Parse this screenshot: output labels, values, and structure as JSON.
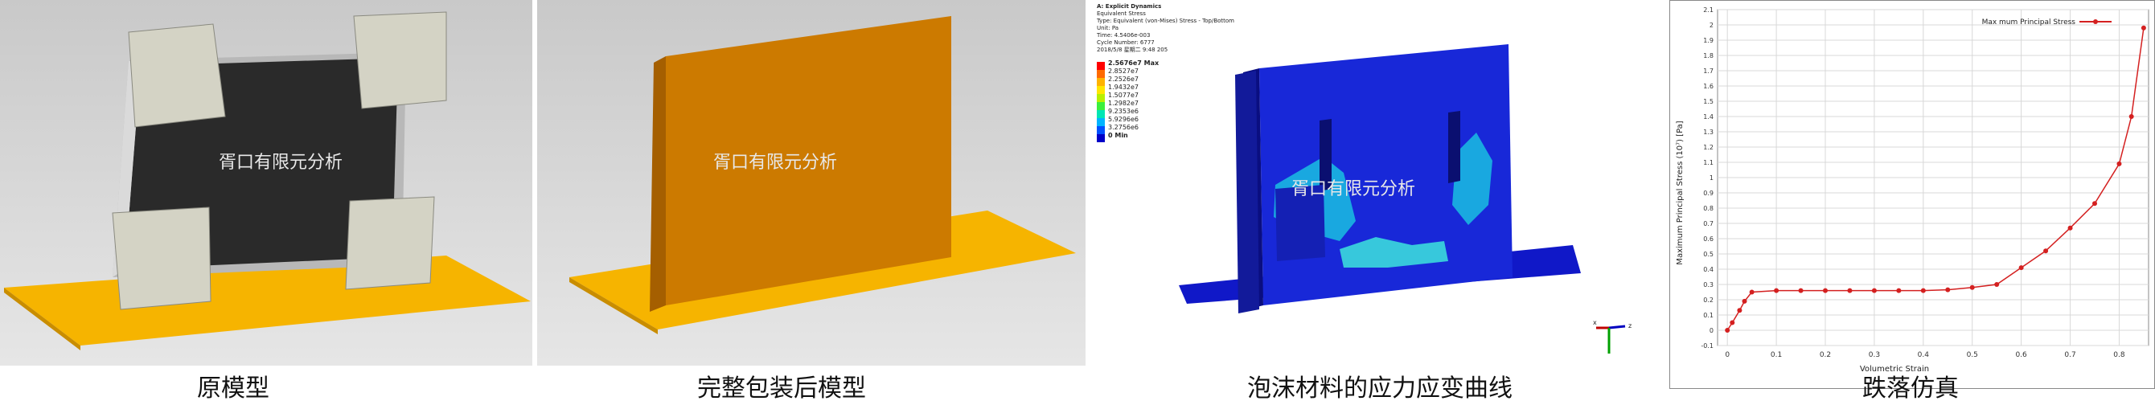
{
  "captions": {
    "original_model": "原模型",
    "packaged_model": "完整包装后模型",
    "foam_curve": "泡沫材料的应力应变曲线",
    "drop_sim": "跌落仿真"
  },
  "watermark": "胥口有限元分析",
  "legend": {
    "header": [
      "A: Explicit Dynamics",
      "Equivalent Stress",
      "Type: Equivalent (von-Mises) Stress - Top/Bottom",
      "Unit: Pa",
      "Time: 4.5406e-003",
      "Cycle Number: 6777",
      "2018/5/8 星期二 9:48 205"
    ],
    "max_label": "2.5676e7 Max",
    "levels": [
      "2.8527e7",
      "2.2526e7",
      "1.9432e7",
      "1.5077e7",
      "1.2982e7",
      "9.2353e6",
      "5.9296e6",
      "3.2756e6"
    ],
    "min_label": "0 Min",
    "colors": [
      "#ff0000",
      "#ff6a00",
      "#ffb300",
      "#ffe600",
      "#b8f000",
      "#3cf03c",
      "#00e6b4",
      "#00b4ff",
      "#0050ff",
      "#0000c8"
    ]
  },
  "triad": {
    "x": "x",
    "z": "z"
  },
  "chart_data": {
    "type": "line",
    "xlabel": "Volumetric Strain",
    "ylabel": "Maximum Principal Stress (10⁷) [Pa]",
    "xlim": [
      -0.02,
      0.86
    ],
    "ylim": [
      -0.1,
      2.1
    ],
    "x_ticks": [
      "0",
      "0.1",
      "0.2",
      "0.3",
      "0.4",
      "0.5",
      "0.6",
      "0.7",
      "0.8"
    ],
    "y_ticks": [
      "-0.1",
      "0",
      "0.1",
      "0.2",
      "0.3",
      "0.4",
      "0.5",
      "0.6",
      "0.7",
      "0.8",
      "0.9",
      "1",
      "1.1",
      "1.2",
      "1.3",
      "1.4",
      "1.5",
      "1.6",
      "1.7",
      "1.8",
      "1.9",
      "2",
      "2.1"
    ],
    "grid": true,
    "legend_placement": "top-right",
    "color": "#d42020",
    "series": [
      {
        "name": "Max mum Principal Stress",
        "x": [
          0,
          0.01,
          0.025,
          0.035,
          0.05,
          0.1,
          0.15,
          0.2,
          0.25,
          0.3,
          0.35,
          0.4,
          0.45,
          0.5,
          0.55,
          0.6,
          0.65,
          0.7,
          0.75,
          0.8,
          0.825,
          0.85
        ],
        "y": [
          0,
          0.05,
          0.13,
          0.19,
          0.25,
          0.26,
          0.26,
          0.26,
          0.26,
          0.26,
          0.26,
          0.26,
          0.265,
          0.28,
          0.3,
          0.41,
          0.52,
          0.67,
          0.83,
          1.09,
          1.4,
          1.98
        ]
      }
    ]
  }
}
